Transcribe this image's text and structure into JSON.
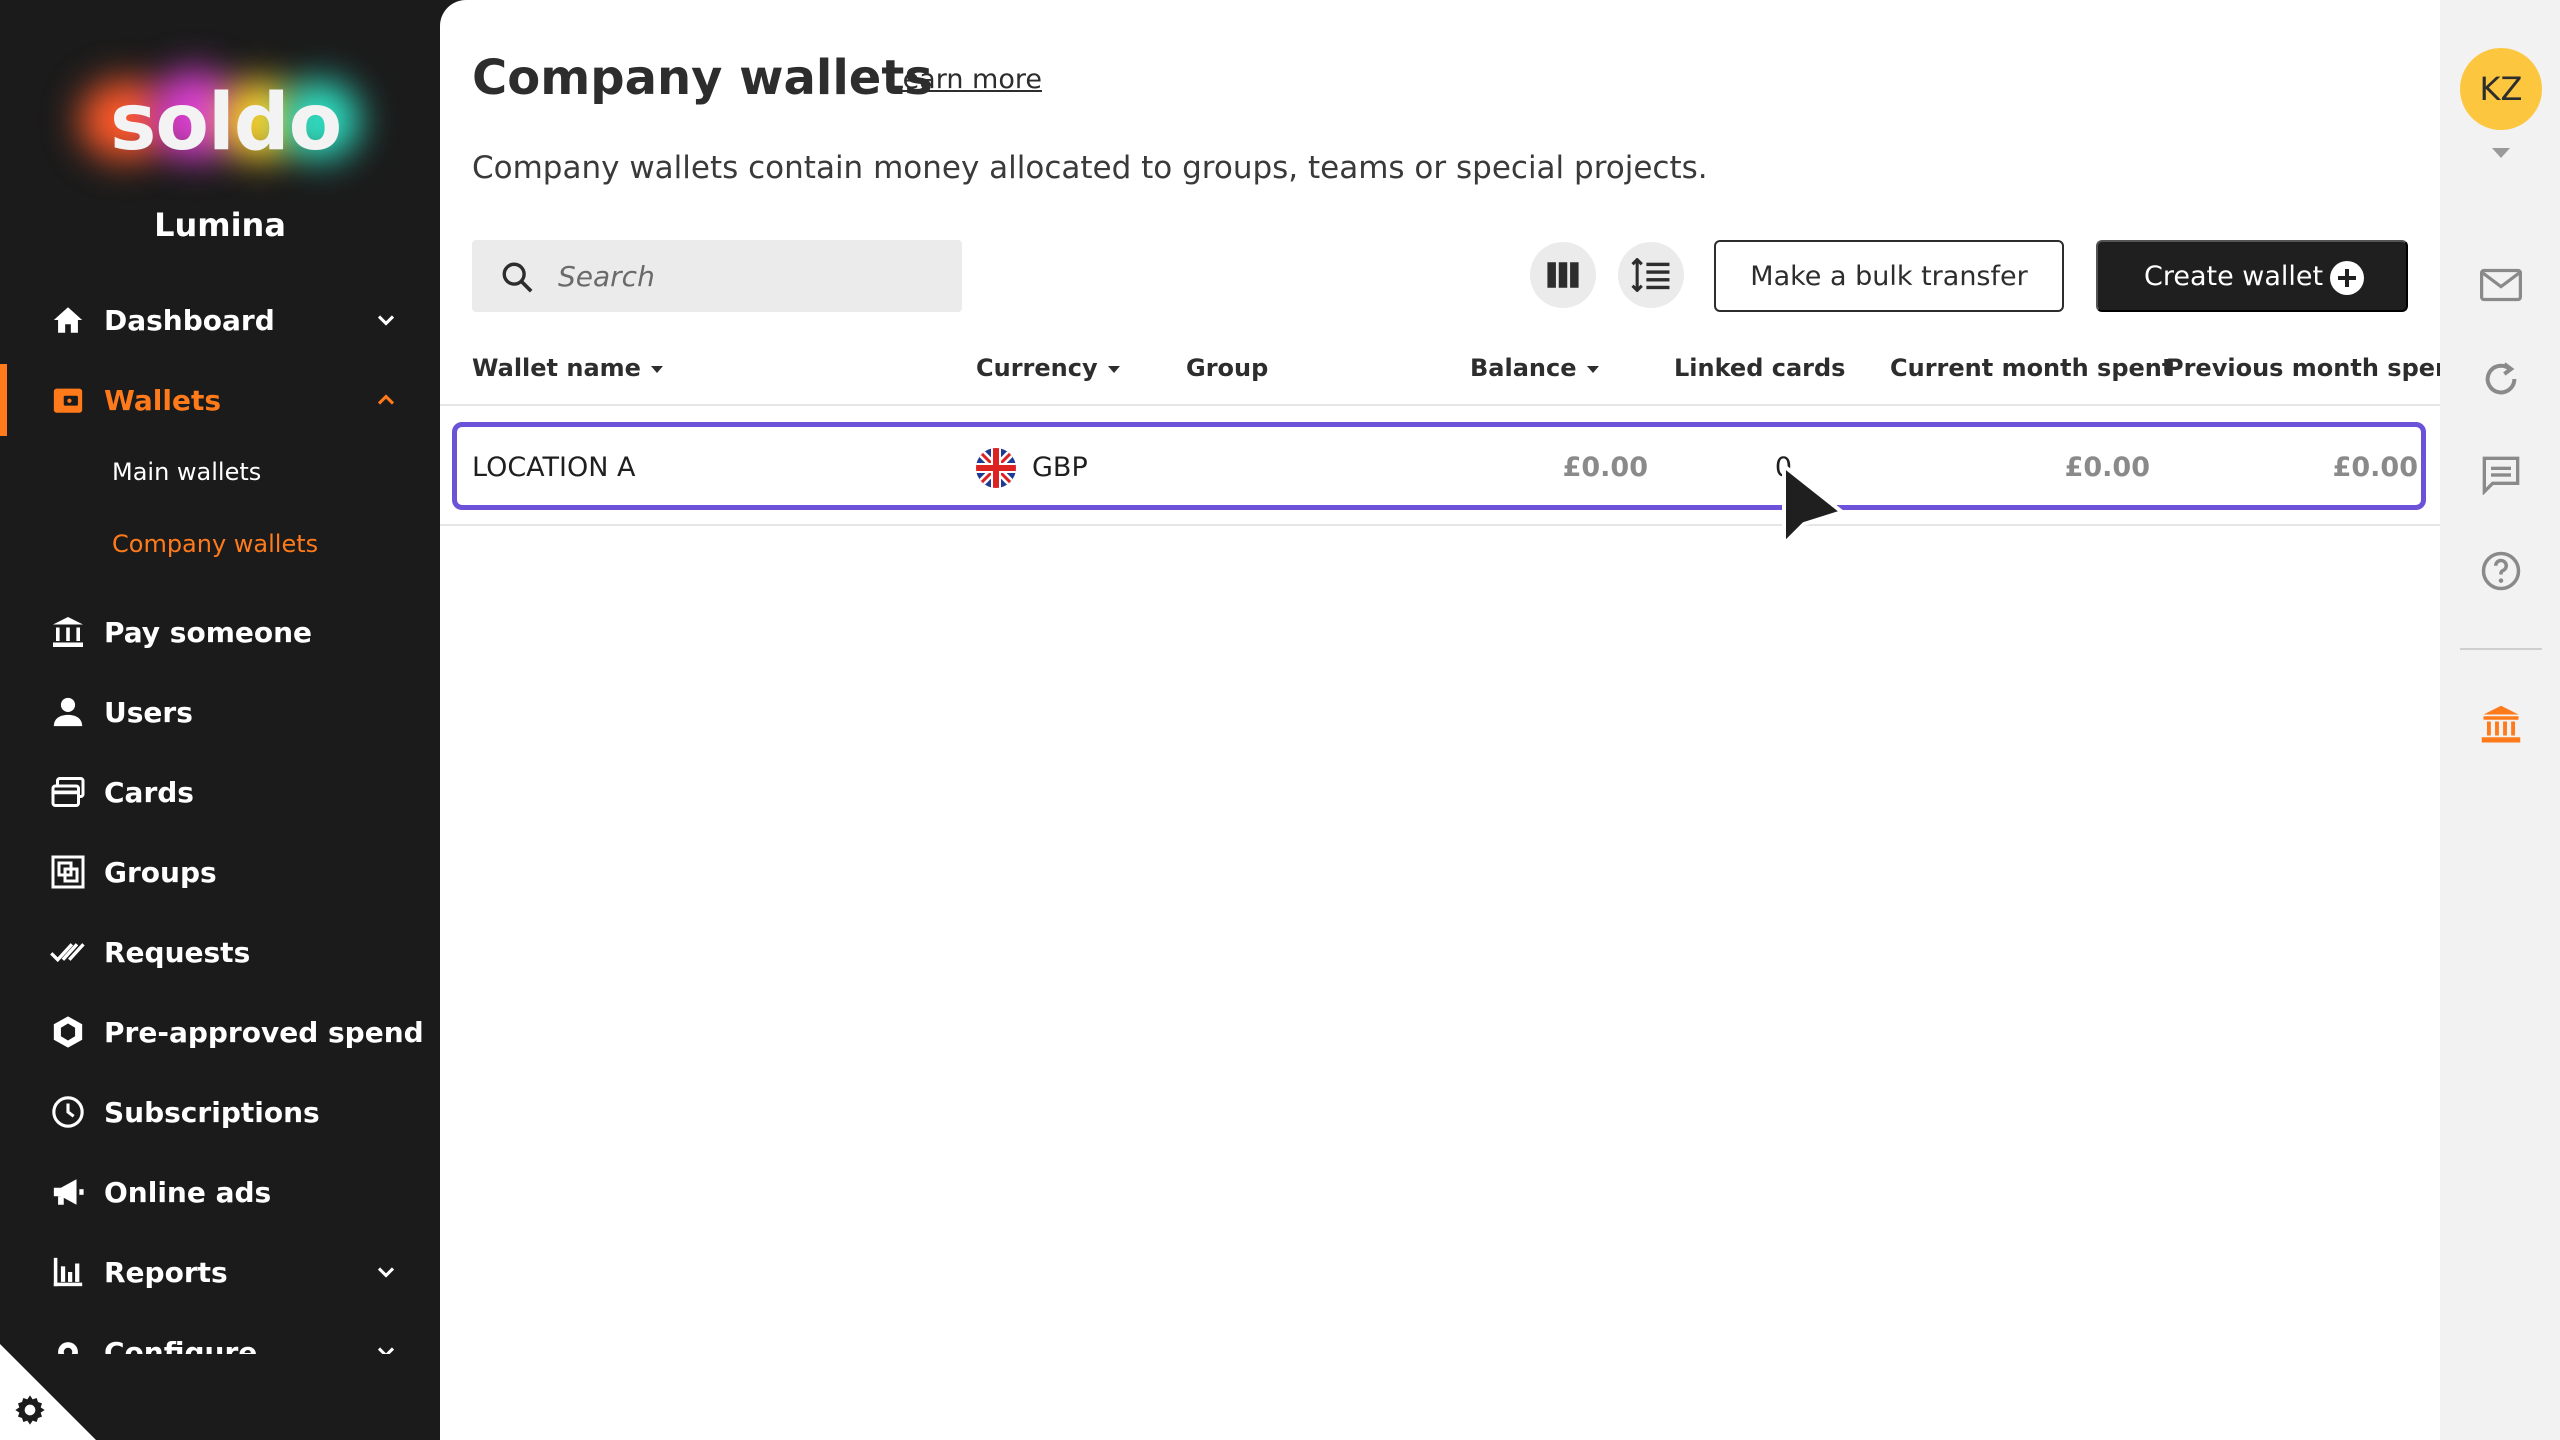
{
  "brand": {
    "logo_text": "soldo",
    "org_name": "Lumina",
    "accent": "#ff7a1a"
  },
  "sidebar": {
    "items": [
      {
        "label": "Dashboard",
        "icon": "home-icon",
        "expandable": true
      },
      {
        "label": "Wallets",
        "icon": "wallet-icon",
        "expandable": true,
        "active": true,
        "children": [
          {
            "label": "Main wallets"
          },
          {
            "label": "Company wallets",
            "active": true
          }
        ]
      },
      {
        "label": "Pay someone",
        "icon": "bank-transfer-icon"
      },
      {
        "label": "Users",
        "icon": "user-icon"
      },
      {
        "label": "Cards",
        "icon": "cards-icon"
      },
      {
        "label": "Groups",
        "icon": "groups-icon"
      },
      {
        "label": "Requests",
        "icon": "double-check-icon"
      },
      {
        "label": "Pre-approved spend",
        "icon": "hexagon-badge-icon"
      },
      {
        "label": "Subscriptions",
        "icon": "clock-icon"
      },
      {
        "label": "Online ads",
        "icon": "megaphone-icon"
      },
      {
        "label": "Reports",
        "icon": "bar-chart-icon",
        "expandable": true
      },
      {
        "label": "Configure",
        "icon": "settings-icon",
        "expandable": true
      }
    ]
  },
  "header": {
    "title": "Company wallets",
    "learn_more": "Learn more",
    "description": "Company wallets contain money allocated to groups, teams or special projects."
  },
  "toolbar": {
    "search_placeholder": "Search",
    "bulk_transfer_label": "Make a bulk transfer",
    "create_wallet_label": "Create wallet"
  },
  "table": {
    "columns": [
      "Wallet name",
      "Currency",
      "Group",
      "Balance",
      "Linked cards",
      "Current month spent",
      "Previous month spent"
    ],
    "rows": [
      {
        "wallet_name": "LOCATION A",
        "currency": "GBP",
        "group": "",
        "balance": "£0.00",
        "linked_cards": "0",
        "current_month_spent": "£0.00",
        "previous_month_spent": "£0.00"
      }
    ]
  },
  "user": {
    "initials": "KZ",
    "avatar_color": "#fcc63f"
  },
  "selection_color": "#6c52d8"
}
